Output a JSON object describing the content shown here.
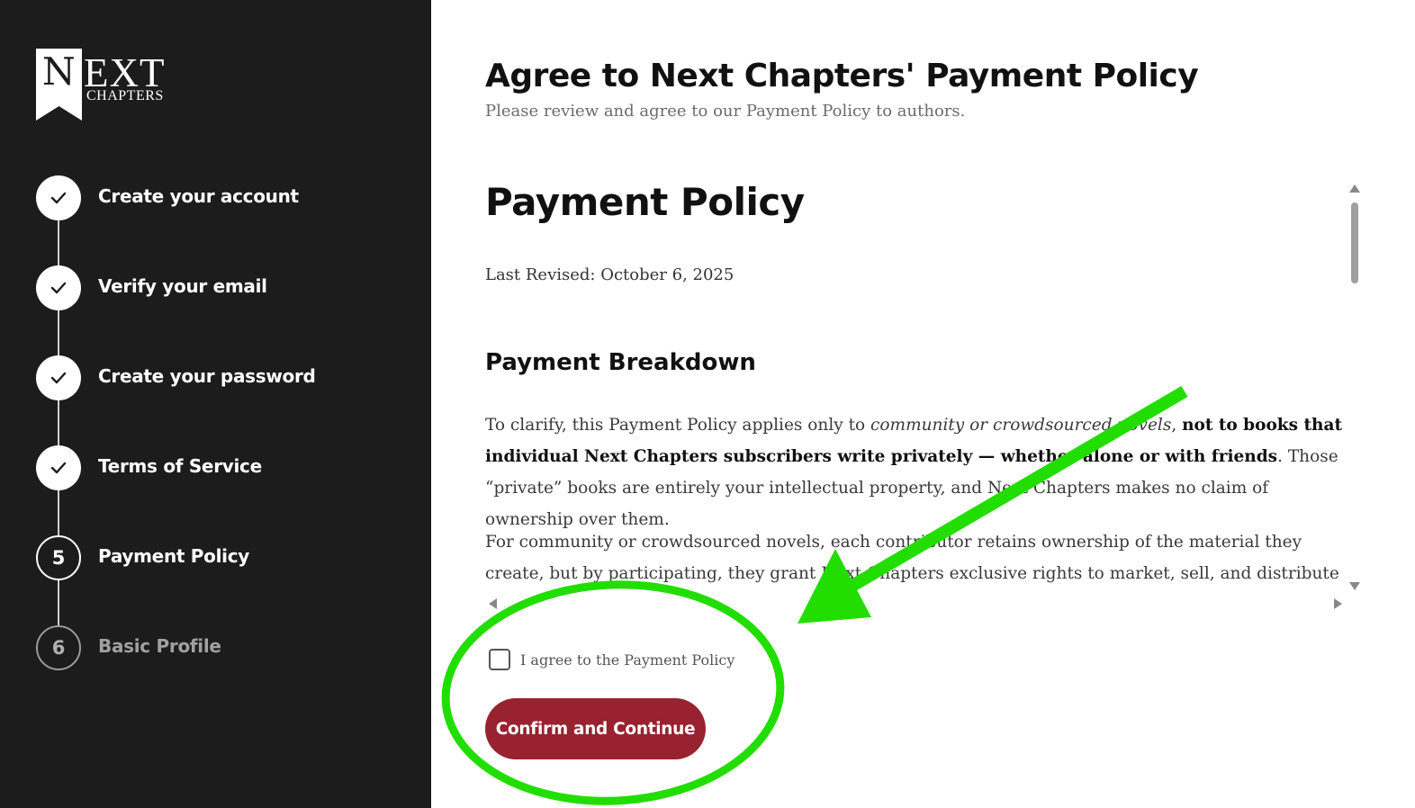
{
  "logo": {
    "letter": "N",
    "rest": "EXT",
    "sub": "CHAPTERS"
  },
  "steps": [
    {
      "label": "Create your account",
      "status": "complete",
      "icon": "check-icon"
    },
    {
      "label": "Verify your email",
      "status": "complete",
      "icon": "check-icon"
    },
    {
      "label": "Create your password",
      "status": "complete",
      "icon": "check-icon"
    },
    {
      "label": "Terms of Service",
      "status": "complete",
      "icon": "check-icon"
    },
    {
      "label": "Payment Policy",
      "status": "current",
      "number": "5"
    },
    {
      "label": "Basic Profile",
      "status": "upcoming",
      "number": "6"
    }
  ],
  "header": {
    "title": "Agree to Next Chapters' Payment Policy",
    "subtitle": "Please review and agree to our Payment Policy to authors."
  },
  "policy": {
    "title": "Payment Policy",
    "last_revised": "Last Revised: October 6, 2025",
    "section_heading": "Payment Breakdown",
    "para1": {
      "part1": "To clarify, this Payment Policy applies only to ",
      "italic": "community or crowdsourced novels",
      "part2": ", ",
      "bold": "not to books that individual Next Chapters subscribers write privately — whether alone or with friends",
      "part3": ". Those “private” books are entirely your intellectual property, and Next Chapters makes no claim of ownership over them."
    },
    "para2": "For community or crowdsourced novels, each contributor retains ownership of the material they create, but by participating, they grant Next Chapters exclusive rights to market, sell, and distribute the completed"
  },
  "agreement": {
    "checkbox_label": "I agree to the Payment Policy",
    "checked": false
  },
  "actions": {
    "confirm_label": "Confirm and Continue"
  },
  "colors": {
    "sidebar_bg": "#1c1c1c",
    "accent": "#98222f",
    "annotation": "#22dd00"
  }
}
